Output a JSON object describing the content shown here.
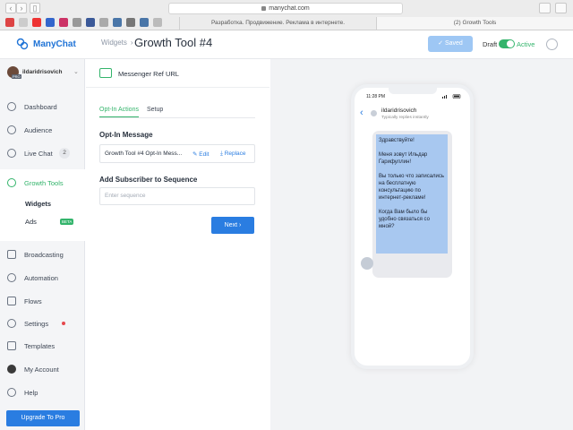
{
  "browser": {
    "url": "manychat.com",
    "tabs": [
      "Разработка. Продвижение. Реклама в интернете.",
      "(2) Growth Tools"
    ]
  },
  "header": {
    "logo": "ManyChat",
    "breadcrumb": "Widgets",
    "breadcrumb_sep": "›",
    "title": "Growth Tool #4",
    "saved": "✓ Saved",
    "draft": "Draft",
    "active": "Active"
  },
  "sidebar": {
    "account_name": "ildaridrisovich",
    "pro_badge": "PRO",
    "items": [
      {
        "label": "Dashboard"
      },
      {
        "label": "Audience"
      },
      {
        "label": "Live Chat"
      },
      {
        "label": "Growth Tools"
      },
      {
        "label": "Broadcasting"
      },
      {
        "label": "Automation"
      },
      {
        "label": "Flows"
      },
      {
        "label": "Settings"
      },
      {
        "label": "Templates"
      },
      {
        "label": "My Account"
      },
      {
        "label": "Help"
      }
    ],
    "livechat_count": "2",
    "sub_items": [
      {
        "label": "Widgets"
      },
      {
        "label": "Ads"
      }
    ],
    "beta": "BETA",
    "upgrade": "Upgrade To Pro"
  },
  "editor": {
    "ref_title": "Messenger Ref URL",
    "tabs": [
      "Opt-In Actions",
      "Setup"
    ],
    "optin_label": "Opt-In Message",
    "message_name": "Growth Tool #4 Opt-In Mess...",
    "edit": "Edit",
    "replace": "Replace",
    "sequence_label": "Add Subscriber to Sequence",
    "sequence_placeholder": "Enter sequence",
    "next": "Next ›"
  },
  "preview": {
    "time": "11:28 PM",
    "chat_name": "ildaridrisovich",
    "chat_sub": "Typically replies instantly",
    "back": "‹",
    "messages": [
      "Здравствуйте!",
      "Меня зовут Ильдар Гарифуллин!",
      "Вы только что записались на бесплатную консультацию по интернет-рекламе!",
      "Когда Вам было бы удобно связаться со мной?"
    ]
  },
  "colors": {
    "accent": "#2a7de1",
    "green": "#33b46b",
    "bubble": "#a8c8f0"
  }
}
